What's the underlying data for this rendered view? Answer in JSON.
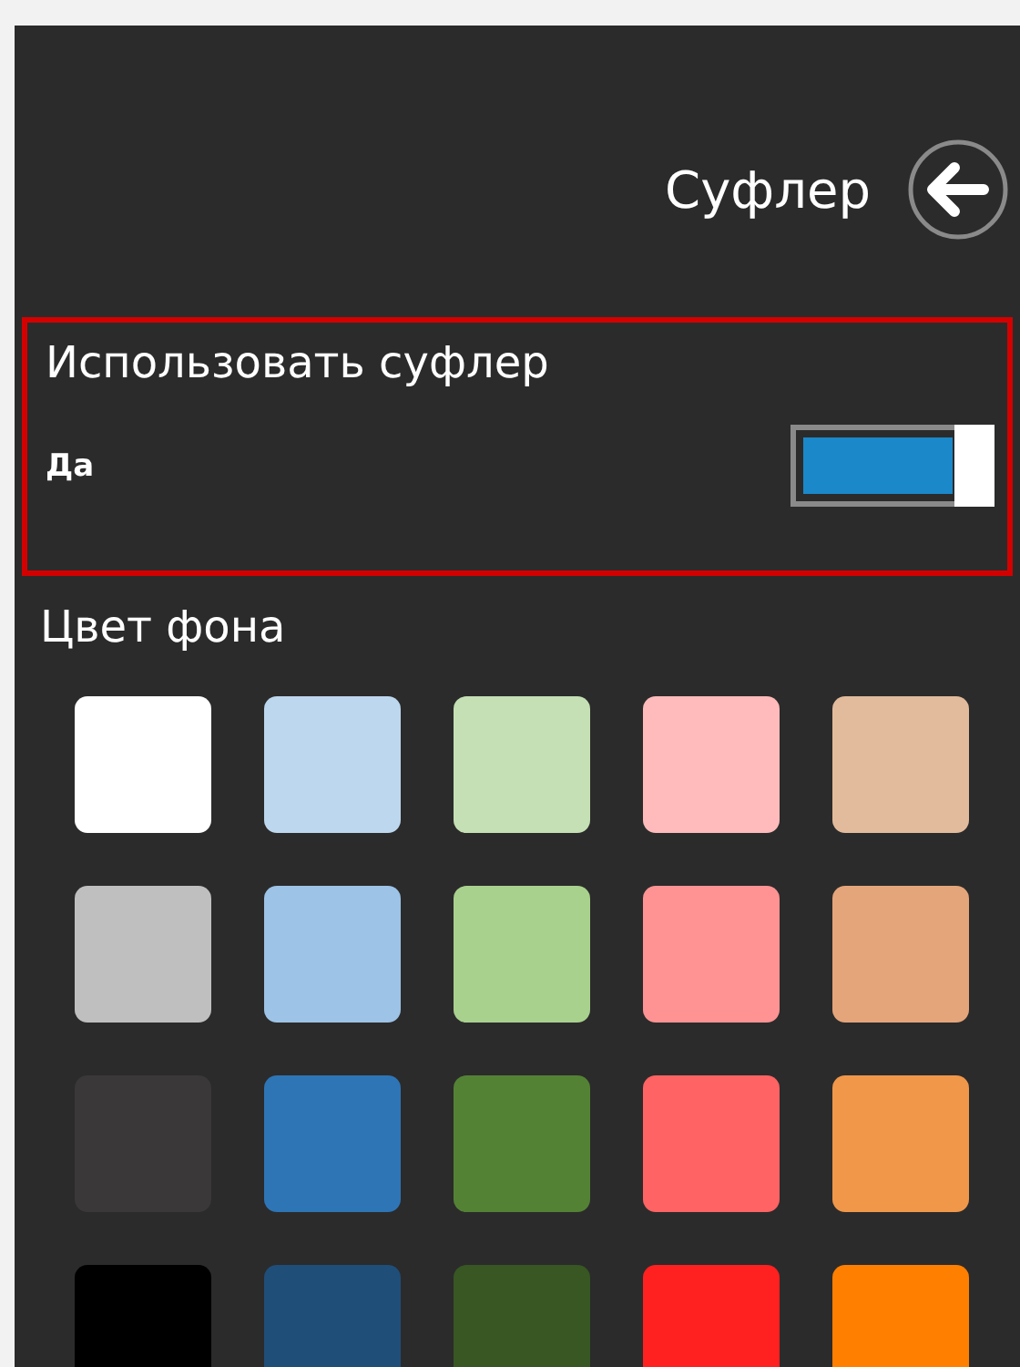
{
  "header": {
    "title": "Суфлер"
  },
  "setting": {
    "label": "Использовать суфлер",
    "value_label": "Да",
    "on": true,
    "highlighted": true
  },
  "background_color": {
    "label": "Цвет фона",
    "swatches": [
      [
        {
          "color": "#ffffff"
        },
        {
          "color": "#bdd7ee"
        },
        {
          "color": "#c5e0b4"
        },
        {
          "color": "#ffbbbb"
        },
        {
          "color": "#e2bb9c"
        }
      ],
      [
        {
          "color": "#bfbfbf"
        },
        {
          "color": "#9dc3e6"
        },
        {
          "color": "#a9d18e"
        },
        {
          "color": "#ff9393"
        },
        {
          "color": "#e5a57a"
        }
      ],
      [
        {
          "color": "#3a3838"
        },
        {
          "color": "#2e75b6"
        },
        {
          "color": "#548235"
        },
        {
          "color": "#ff6363"
        },
        {
          "color": "#f0974a"
        }
      ],
      [
        {
          "color": "#000000"
        },
        {
          "color": "#1f4e79"
        },
        {
          "color": "#385723"
        },
        {
          "color": "#ff2020"
        },
        {
          "color": "#ff7f00"
        }
      ]
    ]
  }
}
